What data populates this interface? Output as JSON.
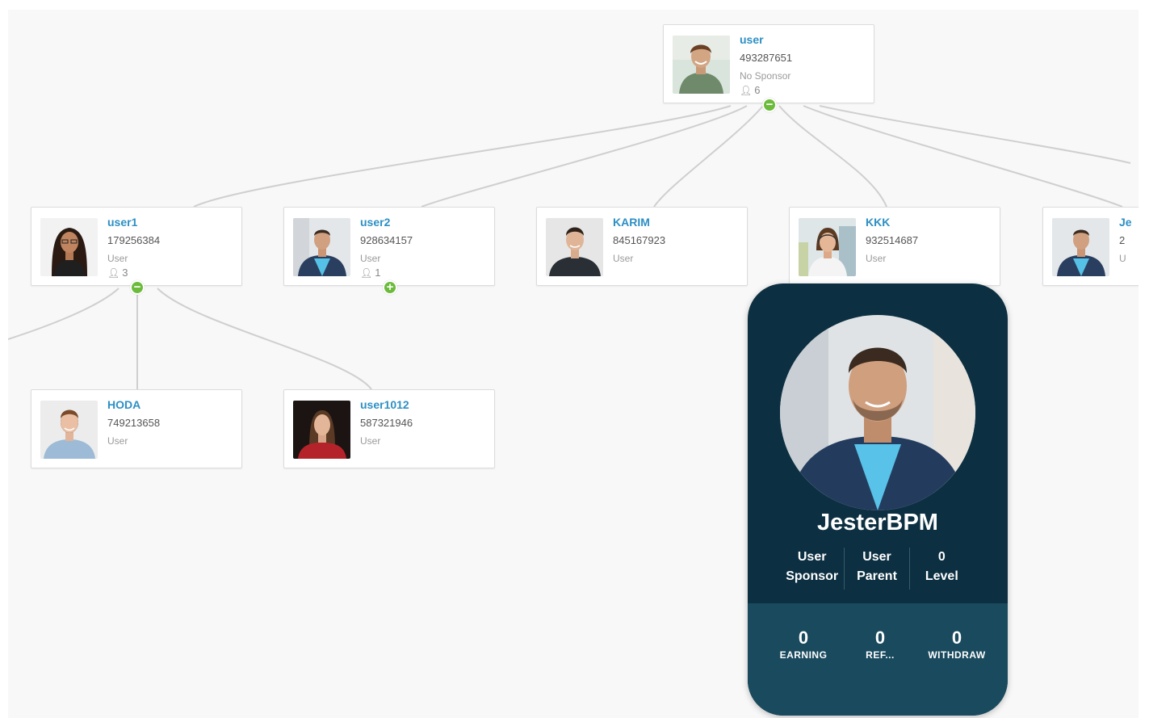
{
  "root": {
    "name": "user",
    "id": "493287651",
    "role": "No Sponsor",
    "count": "6",
    "toggle": "−"
  },
  "level1": [
    {
      "name": "user1",
      "id": "179256384",
      "role": "User",
      "count": "3",
      "toggle": "−"
    },
    {
      "name": "user2",
      "id": "928634157",
      "role": "User",
      "count": "1",
      "toggle": "+"
    },
    {
      "name": "KARIM",
      "id": "845167923",
      "role": "User"
    },
    {
      "name": "KKK",
      "id": "932514687",
      "role": "User"
    },
    {
      "name": "Je",
      "id": "2",
      "role": "U"
    }
  ],
  "level2": [
    {
      "name": "HODA",
      "id": "749213658",
      "role": "User"
    },
    {
      "name": "user1012",
      "id": "587321946",
      "role": "User"
    }
  ],
  "profile_card": {
    "name": "JesterBPM",
    "stats": [
      {
        "value": "User",
        "label": "Sponsor"
      },
      {
        "value": "User",
        "label": "Parent"
      },
      {
        "value": "0",
        "label": "Level"
      }
    ],
    "metrics": [
      {
        "value": "0",
        "label": "EARNING"
      },
      {
        "value": "0",
        "label": "REF..."
      },
      {
        "value": "0",
        "label": "WITHDRAW"
      }
    ]
  },
  "colors": {
    "name_link": "#2d8fc4",
    "toggle": "#6cbb3c",
    "card_bg": "#0c2f41",
    "card_bottom": "#1a4a5e"
  },
  "icons": {
    "count": "person-icon",
    "collapse": "minus-circle-icon",
    "expand": "plus-circle-icon"
  }
}
